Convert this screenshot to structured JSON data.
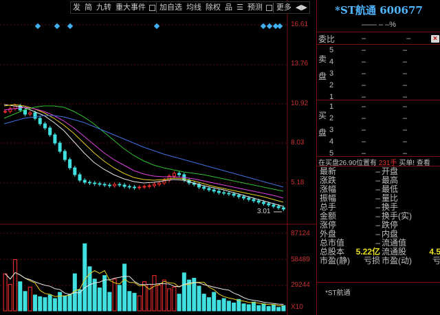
{
  "toolbar": {
    "items": [
      "发",
      "简",
      "九转",
      "重大事件",
      "",
      "加自选",
      "均线",
      "除权",
      "品",
      "☰",
      "预测",
      "",
      "更多",
      "◀▶"
    ]
  },
  "y_axis": {
    "price_ticks": [
      "16.61",
      "13.76",
      "10.92",
      "8.03",
      "5.18",
      "3.01"
    ],
    "volume_ticks": [
      "87124",
      "58489",
      "29244",
      "X10"
    ]
  },
  "chart_data": {
    "type": "candlestick",
    "price_range": [
      2.5,
      17.5
    ],
    "annotation_low": "3.01",
    "close": [
      10.5,
      10.7,
      10.9,
      10.6,
      10.3,
      10.4,
      10.0,
      9.6,
      9.3,
      8.8,
      8.2,
      7.6,
      7.0,
      6.4,
      5.9,
      5.5,
      5.35,
      5.3,
      5.25,
      5.2,
      5.15,
      5.1,
      5.2,
      5.15,
      5.05,
      5.0,
      4.95,
      5.0,
      5.05,
      5.1,
      5.2,
      5.3,
      5.5,
      5.8,
      6.0,
      5.9,
      5.5,
      5.3,
      5.2,
      5.0,
      4.9,
      4.8,
      4.7,
      4.6,
      4.55,
      4.5,
      4.4,
      4.3,
      4.2,
      4.1,
      4.0,
      3.9,
      3.8,
      3.7,
      3.6,
      3.5,
      3.4
    ],
    "volume": [
      42000,
      30000,
      58000,
      33000,
      22000,
      27000,
      18000,
      16000,
      15000,
      18000,
      14000,
      21000,
      17000,
      19000,
      42000,
      24000,
      76000,
      50000,
      36000,
      26000,
      40000,
      21000,
      36000,
      29000,
      53000,
      22000,
      20000,
      17000,
      33000,
      30000,
      40000,
      29000,
      35000,
      25000,
      27000,
      19000,
      43000,
      35000,
      37000,
      28000,
      19000,
      15000,
      21000,
      12000,
      14000,
      11000,
      9000,
      13000,
      8000,
      7000,
      10000,
      6000,
      8000,
      5000,
      7000,
      4000,
      6000
    ],
    "ma_lines": [
      {
        "color": "#e8e8e8",
        "values": [
          11.0,
          10.9,
          10.8,
          10.5,
          10.2,
          9.7,
          9.1,
          8.3,
          7.5,
          6.8,
          6.3,
          5.9,
          5.6,
          5.4,
          5.3,
          5.35,
          5.45,
          5.55,
          5.5,
          5.3,
          5.1,
          4.95,
          4.8,
          4.6,
          4.4,
          4.2,
          4.0,
          3.8,
          3.6
        ]
      },
      {
        "color": "#e8d020",
        "values": [
          10.9,
          11.0,
          10.9,
          10.7,
          10.4,
          10.0,
          9.5,
          8.9,
          8.2,
          7.5,
          6.9,
          6.4,
          6.0,
          5.7,
          5.55,
          5.5,
          5.55,
          5.65,
          5.6,
          5.45,
          5.25,
          5.05,
          4.9,
          4.75,
          4.6,
          4.45,
          4.3,
          4.1,
          3.9
        ]
      },
      {
        "color": "#e040e0",
        "values": [
          10.6,
          10.7,
          10.8,
          10.7,
          10.5,
          10.2,
          9.8,
          9.3,
          8.7,
          8.1,
          7.5,
          7.0,
          6.6,
          6.2,
          5.95,
          5.8,
          5.75,
          5.75,
          5.7,
          5.6,
          5.45,
          5.3,
          5.15,
          5.0,
          4.85,
          4.7,
          4.55,
          4.4,
          4.2
        ]
      },
      {
        "color": "#30c030",
        "values": [
          10.0,
          10.3,
          10.6,
          10.8,
          10.9,
          10.9,
          10.8,
          10.5,
          10.1,
          9.6,
          9.0,
          8.4,
          7.8,
          7.3,
          6.9,
          6.6,
          6.4,
          6.25,
          6.1,
          6.0,
          5.9,
          5.75,
          5.6,
          5.45,
          5.3,
          5.15,
          5.0,
          4.85,
          4.7
        ]
      },
      {
        "color": "#4070e0",
        "values": [
          9.6,
          9.8,
          10.0,
          10.1,
          10.2,
          10.2,
          10.1,
          9.9,
          9.7,
          9.4,
          9.1,
          8.8,
          8.5,
          8.2,
          7.9,
          7.65,
          7.4,
          7.2,
          7.0,
          6.8,
          6.6,
          6.4,
          6.2,
          6.0,
          5.8,
          5.6,
          5.4,
          5.2,
          5.0
        ]
      }
    ],
    "event_markers_x": [
      55,
      83,
      102,
      228,
      383,
      392,
      401,
      407
    ]
  },
  "panel": {
    "title": "*ST航通  600677",
    "price_line": "——  –  –%",
    "weibi_label": "委比",
    "weibi_v1": "–",
    "weibi_v2": "–",
    "close_icon": "×",
    "sell_label": "卖盘",
    "buy_label": "买盘",
    "sell_rows": [
      {
        "lvl": "5",
        "a": "–",
        "b": "–"
      },
      {
        "lvl": "4",
        "a": "–",
        "b": "–"
      },
      {
        "lvl": "3",
        "a": "–",
        "b": "–"
      },
      {
        "lvl": "2",
        "a": "–",
        "b": "–"
      },
      {
        "lvl": "1",
        "a": "–",
        "b": "–"
      }
    ],
    "buy_rows": [
      {
        "lvl": "1",
        "a": "–",
        "b": "–"
      },
      {
        "lvl": "2",
        "a": "–",
        "b": "–"
      },
      {
        "lvl": "3",
        "a": "–",
        "b": "–"
      },
      {
        "lvl": "4",
        "a": "–",
        "b": "–"
      },
      {
        "lvl": "5",
        "a": "–",
        "b": "–"
      }
    ],
    "buy_line_a": "在买盘26.90位置有 ",
    "buy_line_b": "231手",
    "buy_line_c": " 买单!      查看",
    "quotes": [
      {
        "l": "最新",
        "lv": "–",
        "r": "开盘",
        "rv": ""
      },
      {
        "l": "涨跌",
        "lv": "–",
        "r": "最高",
        "rv": ""
      },
      {
        "l": "涨幅",
        "lv": "–",
        "r": "最低",
        "rv": ""
      },
      {
        "l": "振幅",
        "lv": "–",
        "r": "量比",
        "rv": ""
      },
      {
        "l": "总手",
        "lv": "–",
        "r": "换手",
        "rv": ""
      },
      {
        "l": "金额",
        "lv": "–",
        "r": "换手(实)",
        "rv": ""
      },
      {
        "l": "涨停",
        "lv": "–",
        "r": "跌停",
        "rv": ""
      },
      {
        "l": "外盘",
        "lv": "–",
        "r": "内盘",
        "rv": ""
      },
      {
        "l": "总市值",
        "lv": "–",
        "r": "流通值",
        "rv": ""
      },
      {
        "l": "总股本",
        "lv": "5.22亿",
        "r": "流通股",
        "rv": "4.5"
      },
      {
        "l": "市盈(静)",
        "lv": "亏损",
        "r": "市盈(动)",
        "rv": "亏"
      }
    ],
    "tab_name": "*ST航通"
  }
}
